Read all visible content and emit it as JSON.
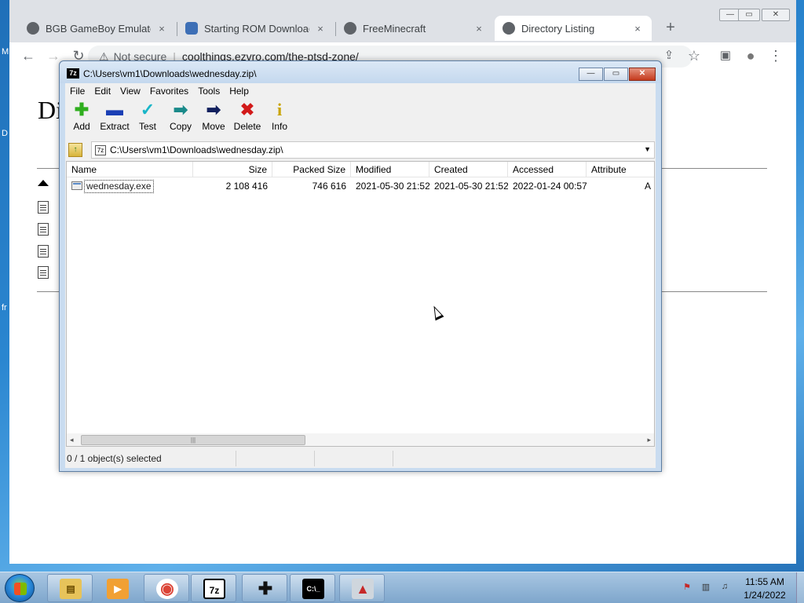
{
  "browser": {
    "tabs": [
      {
        "label": "BGB GameBoy Emulator (…",
        "close": "×",
        "favicon_color": "#5f6368"
      },
      {
        "label": "Starting ROM Download f…",
        "close": "×",
        "favicon_color": "#3d6fb6"
      },
      {
        "label": "FreeMinecraft",
        "close": "×",
        "favicon_color": "#5f6368"
      },
      {
        "label": "Directory Listing",
        "close": "×",
        "favicon_color": "#5f6368"
      }
    ],
    "new_tab": "+",
    "window_controls": {
      "minimize": "—",
      "maximize": "▭",
      "close": "✕"
    },
    "nav": {
      "back": "←",
      "forward": "→",
      "reload": "↻"
    },
    "address": {
      "security": "Not secure",
      "url": "coolthings.ezvro.com/the-ptsd-zone/"
    },
    "toolbar_icons": {
      "share": "⇪",
      "bookmark": "☆",
      "sidepanel": "▣",
      "profile": "●",
      "menu": "⋮"
    },
    "page": {
      "title_fragment": "Di"
    }
  },
  "desktop_edge": [
    "M",
    "D",
    "fr"
  ],
  "zip": {
    "title": "C:\\Users\\vm1\\Downloads\\wednesday.zip\\",
    "app_icon": "7z",
    "window_controls": {
      "minimize": "—",
      "maximize": "▭",
      "close": "✕"
    },
    "menu": [
      "File",
      "Edit",
      "View",
      "Favorites",
      "Tools",
      "Help"
    ],
    "tools": [
      {
        "label": "Add",
        "icon": "✚",
        "color": "#2fae1e"
      },
      {
        "label": "Extract",
        "icon": "▬",
        "color": "#1a3fb5"
      },
      {
        "label": "Test",
        "icon": "✓",
        "color": "#19b6c8"
      },
      {
        "label": "Copy",
        "icon": "➡",
        "color": "#1a8a8a"
      },
      {
        "label": "Move",
        "icon": "➡",
        "color": "#12205e"
      },
      {
        "label": "Delete",
        "icon": "✖",
        "color": "#d21a1a"
      },
      {
        "label": "Info",
        "icon": "i",
        "color": "#c9a400"
      }
    ],
    "up_icon": "↑",
    "address": "C:\\Users\\vm1\\Downloads\\wednesday.zip\\",
    "address_icon": "7z",
    "columns": [
      "Name",
      "Size",
      "Packed Size",
      "Modified",
      "Created",
      "Accessed",
      "Attribute"
    ],
    "files": [
      {
        "name": "wednesday.exe",
        "size": "2 108 416",
        "packed": "746 616",
        "modified": "2021-05-30 21:52",
        "created": "2021-05-30 21:52",
        "accessed": "2022-01-24 00:57",
        "attr": "A"
      }
    ],
    "scroll": {
      "left": "◂",
      "right": "▸",
      "grip": "|||"
    },
    "status": "0 / 1 object(s) selected"
  },
  "taskbar": {
    "apps": [
      {
        "name": "File Explorer",
        "glyph": "▤",
        "bg": "#e7c35a",
        "fg": "#6a4b00"
      },
      {
        "name": "Media Player",
        "glyph": "▶",
        "bg": "#f1a033",
        "fg": "#fff"
      },
      {
        "name": "Chrome",
        "glyph": "◉",
        "bg": "#ffffff",
        "fg": "#db4437"
      },
      {
        "name": "7-Zip",
        "glyph": "7z",
        "bg": "#ffffff",
        "fg": "#000"
      },
      {
        "name": "Game",
        "glyph": "✚",
        "bg": "#555555",
        "fg": "#111"
      },
      {
        "name": "Command Prompt",
        "glyph": "C:\\_",
        "bg": "#000000",
        "fg": "#fff"
      },
      {
        "name": "Java App",
        "glyph": "▲",
        "bg": "#cfd6dd",
        "fg": "#c62828"
      }
    ],
    "tray_icons": [
      "⚑",
      "▥",
      "♫"
    ],
    "time": "11:55 AM",
    "date": "1/24/2022"
  }
}
